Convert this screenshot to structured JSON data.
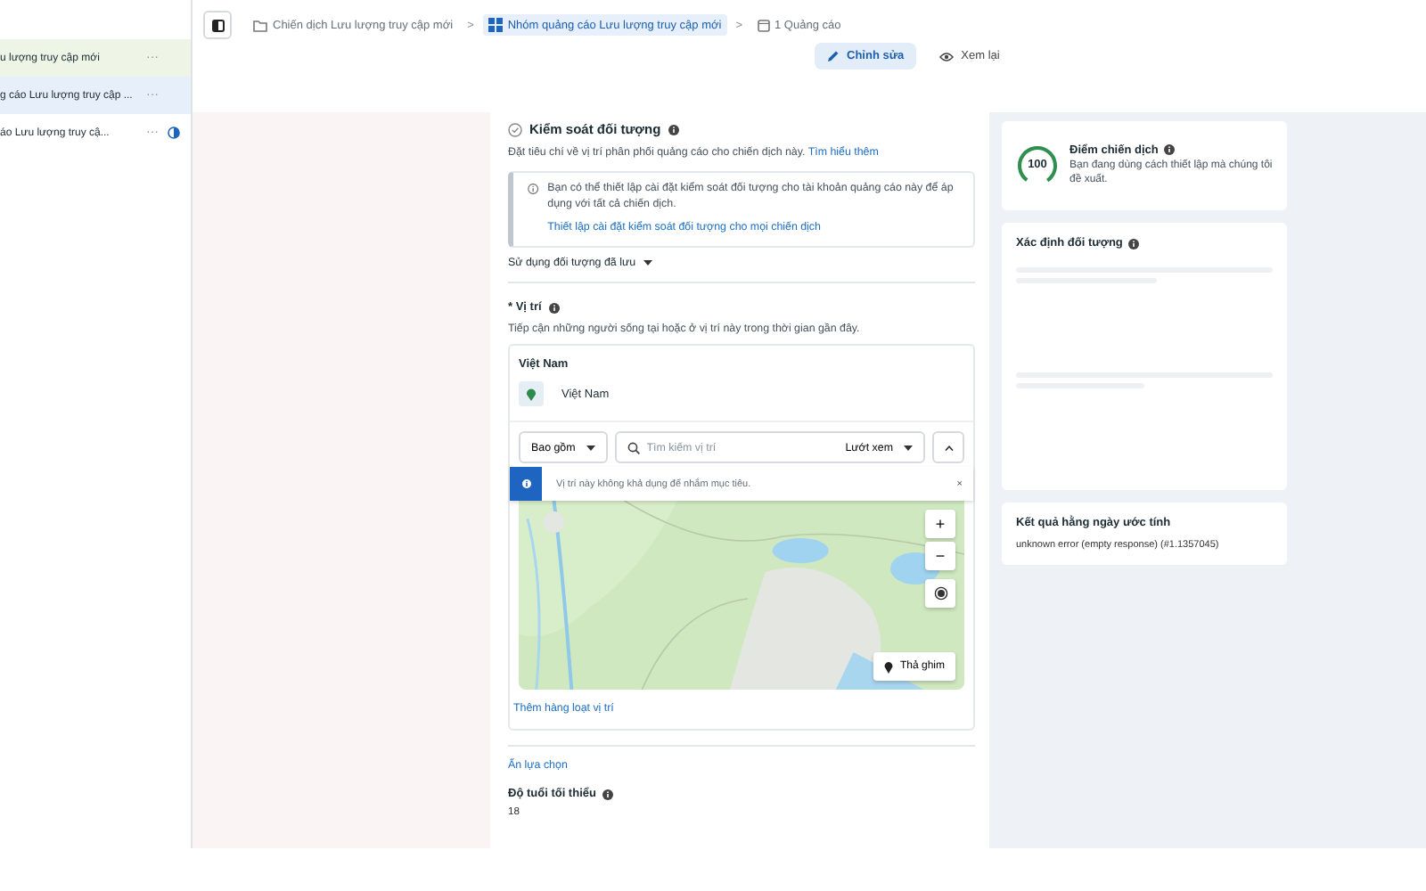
{
  "sidebar": {
    "items": [
      {
        "kind": "campaign",
        "label": "u lượng truy cập mới",
        "selected": false,
        "more": "···"
      },
      {
        "kind": "adset",
        "label": "g cáo Lưu lượng truy cập ...",
        "selected": true,
        "more": "···"
      },
      {
        "kind": "ad",
        "label": "áo Lưu lượng truy cậ...",
        "selected": false,
        "more": "···"
      }
    ]
  },
  "breadcrumb": [
    {
      "kind": "campaign",
      "label": "Chiến dịch Lưu lượng truy cập mới",
      "selected": false
    },
    {
      "kind": "adset",
      "separator": ">",
      "label": "Nhóm quảng cáo Lưu lượng truy cập mới",
      "selected": true
    },
    {
      "kind": "ad",
      "separator": ">",
      "label": "1 Quảng cáo",
      "selected": false
    }
  ],
  "mode_tabs": [
    {
      "kind": "edit",
      "label": "Chỉnh sửa",
      "selected": true
    },
    {
      "kind": "review",
      "label": "Xem lại",
      "selected": false
    }
  ],
  "audience_controls": {
    "title": "Kiểm soát đối tượng",
    "description": "Đặt tiêu chí về vị trí phân phối quảng cáo cho chiến dịch này.",
    "learn_more": "Tìm hiểu thêm",
    "notice": {
      "text": "Bạn có thể thiết lập cài đặt kiểm soát đối tượng cho tài khoản quảng cáo này để áp dụng với tất cả chiến dịch.",
      "link": "Thiết lập cài đặt kiểm soát đối tượng cho mọi chiến dịch"
    },
    "saved_audience": "Sử dụng đối tượng đã lưu"
  },
  "location": {
    "label": "* Vị trí",
    "description": "Tiếp cận những người sống tại hoặc ở vị trí này trong thời gian gần đây.",
    "country_heading": "Việt Nam",
    "items": [
      {
        "label": "Việt Nam"
      }
    ],
    "include_select": "Bao gồm",
    "search": {
      "placeholder": "Tìm kiếm vị trí"
    },
    "browse": "Lướt xem",
    "alert": "Vị trí này không khả dụng để nhắm mục tiêu.",
    "alert_close": "×",
    "map": {
      "kind": "picture",
      "zoom_in": "+",
      "zoom_out": "−",
      "pin_button": "Thả ghim"
    },
    "bulk_link": "Thêm hàng loạt vị trí"
  },
  "hide_options": "Ẩn lựa chọn",
  "min_age": {
    "label": "Độ tuổi tối thiểu",
    "value": "18"
  },
  "score_card": {
    "value": "100",
    "title": "Điểm chiến dịch",
    "text": "Bạn đang dùng cách thiết lập mà chúng tôi đề xuất."
  },
  "targeting_card": {
    "title": "Xác định đối tượng"
  },
  "estimate_card": {
    "title": "Kết quả hằng ngày ước tính",
    "text": "unknown error (empty response) (#1.1357045)"
  }
}
